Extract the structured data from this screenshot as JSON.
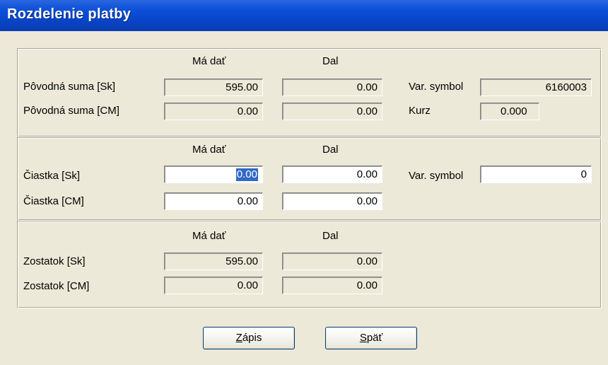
{
  "window": {
    "title": "Rozdelenie platby"
  },
  "original": {
    "col_debit": "Má dať",
    "col_credit": "Dal",
    "row_sk": {
      "label": "Pôvodná suma [Sk]",
      "debit": "595.00",
      "credit": "0.00"
    },
    "row_cm": {
      "label": "Pôvodná suma [CM]",
      "debit": "0.00",
      "credit": "0.00"
    },
    "var_symbol_label": "Var. symbol",
    "var_symbol_value": "6160003",
    "rate_label": "Kurz",
    "rate_value": "0.000"
  },
  "amount": {
    "col_debit": "Má dať",
    "col_credit": "Dal",
    "row_sk": {
      "label": "Čiastka [Sk]",
      "debit": "0.00",
      "credit": "0.00"
    },
    "row_cm": {
      "label": "Čiastka [CM]",
      "debit": "0.00",
      "credit": "0.00"
    },
    "var_symbol_label": "Var. symbol",
    "var_symbol_value": "0"
  },
  "remainder": {
    "col_debit": "Má dať",
    "col_credit": "Dal",
    "row_sk": {
      "label": "Zostatok [Sk]",
      "debit": "595.00",
      "credit": "0.00"
    },
    "row_cm": {
      "label": "Zostatok [CM]",
      "debit": "0.00",
      "credit": "0.00"
    }
  },
  "buttons": {
    "save": {
      "mnemonic": "Z",
      "rest": "ápis"
    },
    "back": {
      "mnemonic": "S",
      "rest": "päť"
    }
  }
}
